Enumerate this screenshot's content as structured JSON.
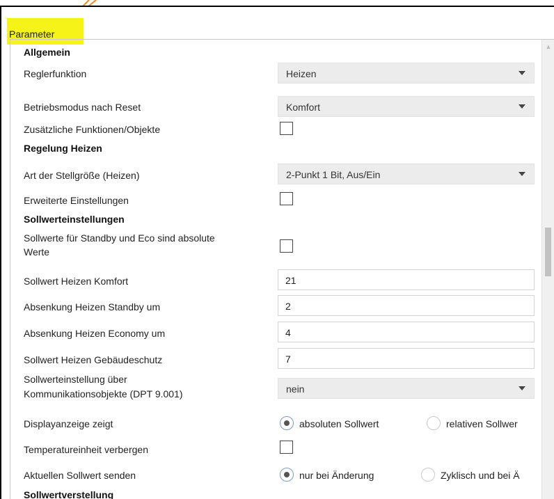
{
  "tab": {
    "label": "Parameter",
    "highlight_color": "#f5f317"
  },
  "sections": {
    "allgemein": "Allgemein",
    "regelung_heizen": "Regelung Heizen",
    "sollwerteinstellungen": "Sollwerteinstellungen",
    "sollwertverstellung": "Sollwertverstellung"
  },
  "rows": {
    "reglerfunktion": {
      "label": "Reglerfunktion",
      "value": "Heizen"
    },
    "betriebsmodus": {
      "label": "Betriebsmodus nach Reset",
      "value": "Komfort"
    },
    "zusatz": {
      "label": "Zusätzliche Funktionen/Objekte",
      "checked": false
    },
    "stellgroesse": {
      "label": "Art der Stellgröße (Heizen)",
      "value": "2-Punkt 1 Bit, Aus/Ein"
    },
    "erweitert": {
      "label": "Erweiterte Einstellungen",
      "checked": false
    },
    "absolut": {
      "label_line1": "Sollwerte für Standby und Eco sind absolute",
      "label_line2": "Werte",
      "checked": false
    },
    "komfort": {
      "label": "Sollwert Heizen Komfort",
      "value": "21"
    },
    "standby": {
      "label": "Absenkung Heizen Standby um",
      "value": "2"
    },
    "economy": {
      "label": "Absenkung Heizen Economy um",
      "value": "4"
    },
    "gebaeudeschutz": {
      "label": "Sollwert Heizen Gebäudeschutz",
      "value": "7"
    },
    "kommobjekte": {
      "label_line1": "Sollwerteinstellung über",
      "label_line2": "Kommunikationsobjekte (DPT 9.001)",
      "value": "nein"
    },
    "display": {
      "label": "Displayanzeige zeigt",
      "option1": "absoluten Sollwert",
      "option2": "relativen Sollwer",
      "selected": "option1"
    },
    "tempeinheit": {
      "label": "Temperatureinheit verbergen",
      "checked": false
    },
    "senden": {
      "label": "Aktuellen Sollwert senden",
      "option1": "nur bei Änderung",
      "option2": "Zyklisch und bei Ä",
      "selected": "option1"
    }
  },
  "icons": {
    "scroll_up": "chevron-up-icon",
    "dropdown": "dropdown-arrow-icon",
    "annotation": "orange-arrow-annotation"
  },
  "colors": {
    "annotation_arrow": "#f0891d",
    "radio_selected_ring": "#7b9bc4"
  }
}
